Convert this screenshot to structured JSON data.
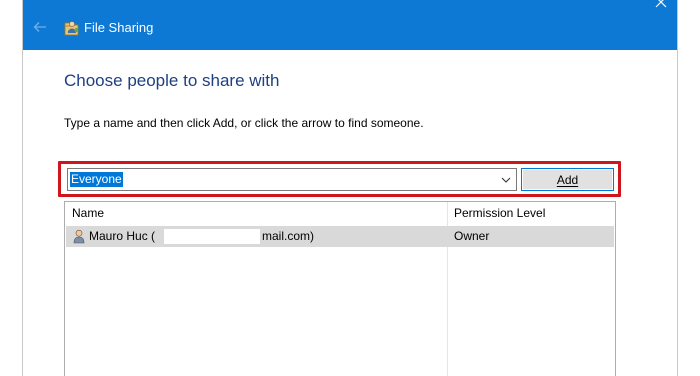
{
  "window": {
    "title": "File Sharing",
    "accent_color": "#0e78d5",
    "icons": {
      "back": "back-arrow-icon",
      "app": "file-sharing-icon",
      "close": "close-icon"
    }
  },
  "main": {
    "heading": "Choose people to share with",
    "instruction": "Type a name and then click Add, or click the arrow to find someone.",
    "name_input": {
      "value": "Everyone",
      "highlight_color": "#d0161b"
    },
    "add_button": {
      "label": "Add"
    }
  },
  "share_list": {
    "columns": [
      "Name",
      "Permission Level"
    ],
    "rows": [
      {
        "name_prefix": "Mauro Huc (",
        "name_suffix": "mail.com)",
        "permission": "Owner",
        "icon": "user-icon"
      }
    ]
  }
}
